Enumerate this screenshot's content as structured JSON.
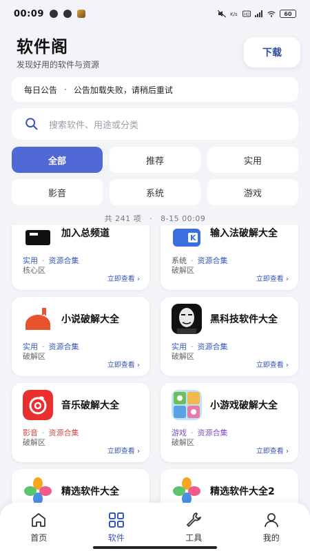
{
  "status_bar": {
    "time": "00:09",
    "battery": "60"
  },
  "header": {
    "title": "软件阁",
    "subtitle": "发现好用的软件与资源",
    "download_label": "下载"
  },
  "notice": {
    "label": "每日公告",
    "dot": "·",
    "text": "公告加载失败，请稍后重试"
  },
  "search": {
    "placeholder": "搜索软件、用途或分类"
  },
  "categories": [
    "全部",
    "推荐",
    "实用",
    "影音",
    "系统",
    "游戏"
  ],
  "active_category": "全部",
  "summary": {
    "count_text": "共 241 项",
    "sep": "·",
    "updated": "8-15 00:09"
  },
  "cards": [
    {
      "title": "加入总频道",
      "tag": "实用",
      "collection": "资源合集",
      "zone": "核心区",
      "view": "立即查看 ›",
      "icon": "channel-logo"
    },
    {
      "title": "输入法破解大全",
      "tag": "系统",
      "collection": "资源合集",
      "zone": "破解区",
      "view": "立即查看 ›",
      "icon": "keyboard-logo"
    },
    {
      "title": "小说破解大全",
      "tag": "实用",
      "collection": "资源合集",
      "zone": "破解区",
      "view": "立即查看 ›",
      "icon": "novel-logo"
    },
    {
      "title": "黑科技软件大全",
      "tag": "实用",
      "collection": "资源合集",
      "zone": "破解区",
      "view": "立即查看 ›",
      "icon": "hacker-mask-logo"
    },
    {
      "title": "音乐破解大全",
      "tag": "影音",
      "collection": "资源合集",
      "zone": "破解区",
      "view": "立即查看 ›",
      "icon": "music-logo"
    },
    {
      "title": "小游戏破解大全",
      "tag": "游戏",
      "collection": "资源合集",
      "zone": "破解区",
      "view": "立即查看 ›",
      "icon": "game-collage-logo"
    },
    {
      "title": "精选软件大全",
      "icon": "colorful-petal-logo"
    },
    {
      "title": "精选软件大全2",
      "icon": "colorful-petal-logo"
    }
  ],
  "bottom_nav": [
    {
      "label": "首页",
      "icon": "home-icon"
    },
    {
      "label": "软件",
      "icon": "grid-icon",
      "active": true
    },
    {
      "label": "工具",
      "icon": "wrench-icon"
    },
    {
      "label": "我的",
      "icon": "person-icon"
    }
  ],
  "colors": {
    "accent": "#5069d6",
    "link": "#3856b8",
    "tag_red": "#d04a4a",
    "tag_purple": "#7b4fc7"
  }
}
